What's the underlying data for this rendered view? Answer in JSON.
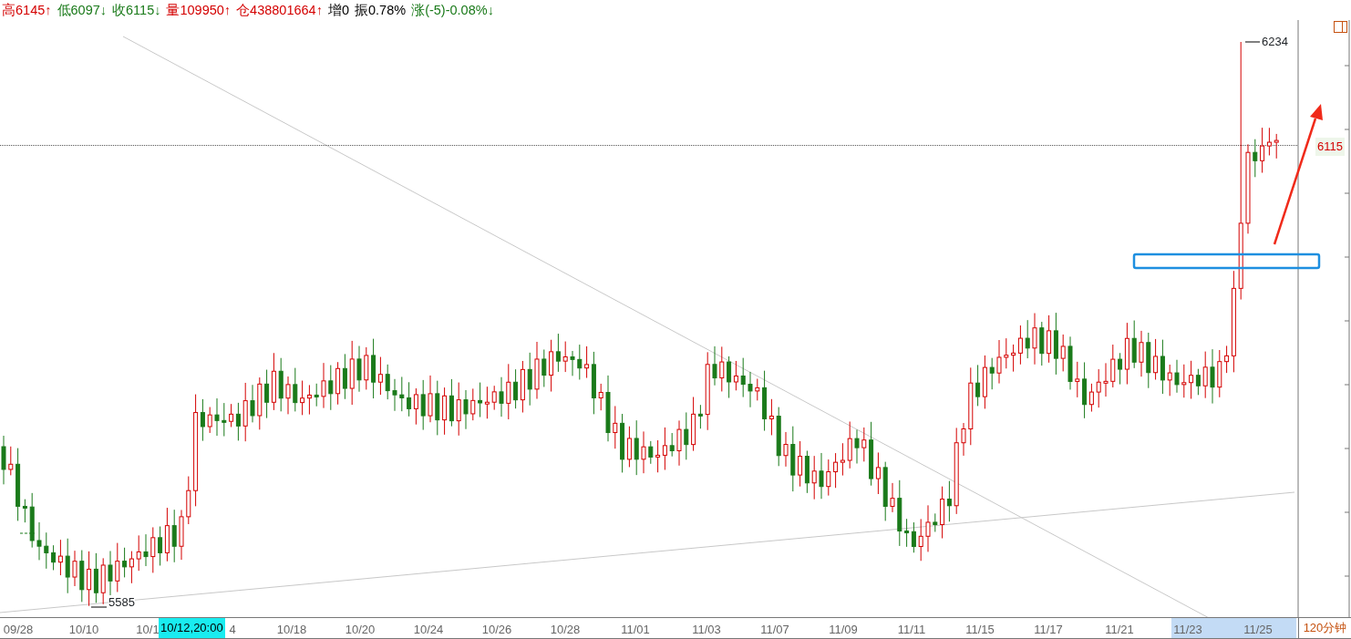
{
  "quote_bar": [
    {
      "label": "高",
      "value": "6145",
      "arrow": "↑",
      "color": "#d40000"
    },
    {
      "label": "低",
      "value": "6097",
      "arrow": "↓",
      "color": "#1a7a1a"
    },
    {
      "label": "收",
      "value": "6115",
      "arrow": "↓",
      "color": "#1a7a1a"
    },
    {
      "label": "量",
      "value": "109950",
      "arrow": "↑",
      "color": "#d40000"
    },
    {
      "label": "仓",
      "value": "438801664",
      "arrow": "↑",
      "color": "#d40000"
    },
    {
      "label": "增",
      "value": "0",
      "color": "#000000"
    },
    {
      "label": "振",
      "value": "0.78%",
      "color": "#000000"
    },
    {
      "label": "涨",
      "value": "(-5)-0.08%",
      "arrow": "↓",
      "color": "#1a7a1a"
    }
  ],
  "chart": {
    "high_label": "6234",
    "low_label": "5585",
    "current_price": "6115"
  },
  "x_axis": {
    "labels": [
      "09/28",
      "10/10",
      "10/1",
      "4",
      "10/18",
      "10/20",
      "10/24",
      "10/26",
      "10/28",
      "11/01",
      "11/03",
      "11/07",
      "11/09",
      "11/11",
      "11/15",
      "11/17",
      "11/21",
      "11/23",
      "11/25"
    ],
    "crosshair_time": "10/12,20:00",
    "period": "120分钟"
  }
}
